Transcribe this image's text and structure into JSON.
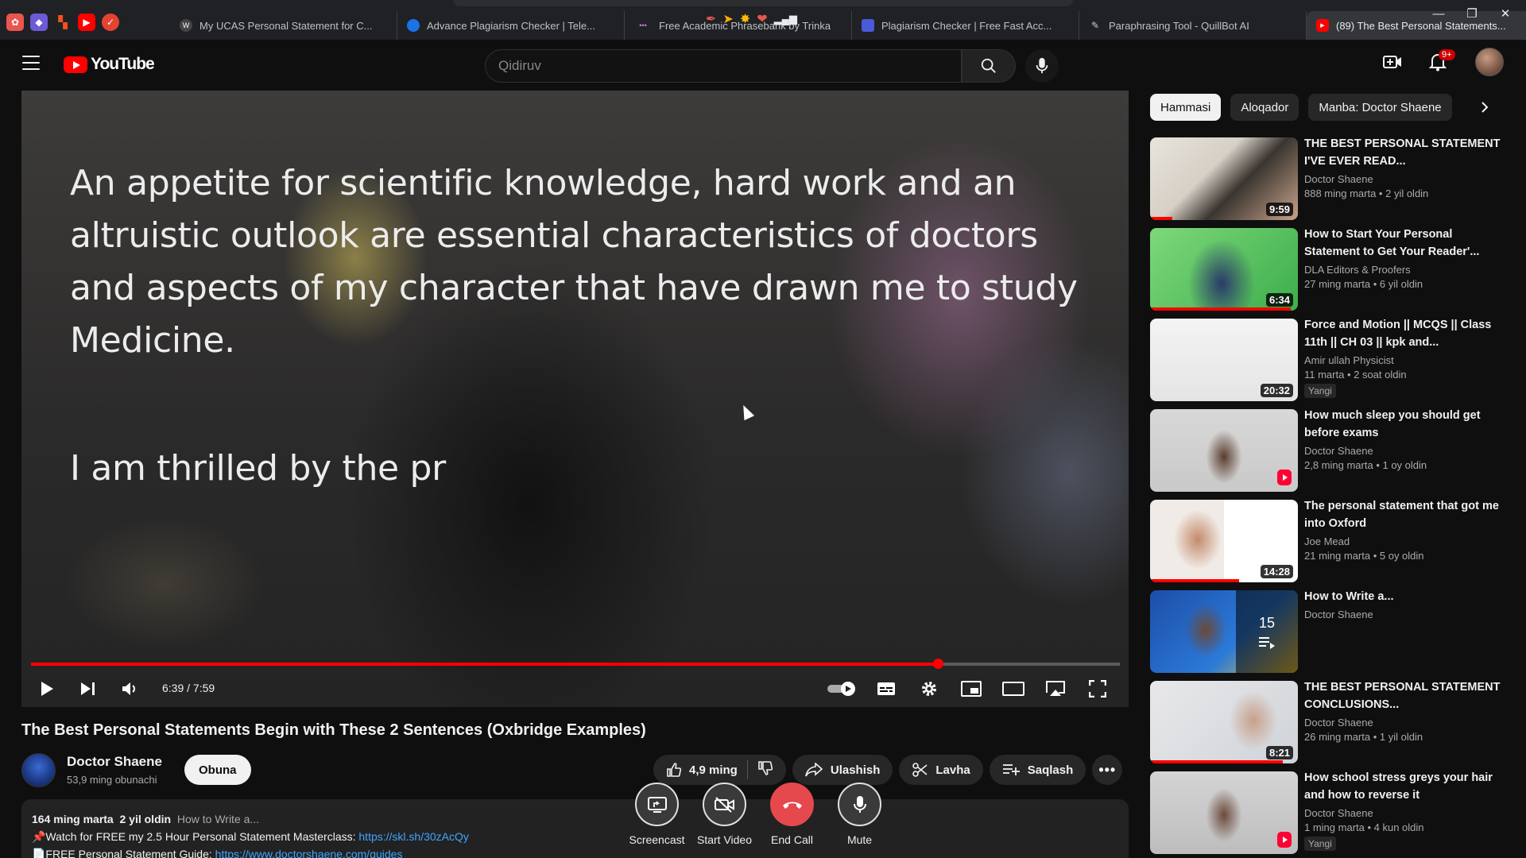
{
  "browser": {
    "tabs": [
      {
        "title": "My UCAS Personal Statement for C...",
        "fav": "W",
        "color": "#444"
      },
      {
        "title": "Advance Plagiarism Checker | Tele...",
        "fav": "",
        "color": "#1a73e8"
      },
      {
        "title": "Free Academic Phrasebank by Trinka",
        "fav": "•••",
        "color": "#202124"
      },
      {
        "title": "Plagiarism Checker | Free Fast Acc...",
        "fav": "",
        "color": "#4a5ad8"
      },
      {
        "title": "Paraphrasing Tool - QuillBot AI",
        "fav": "",
        "color": "#202124"
      },
      {
        "title": "(89) The Best Personal Statements...",
        "fav": "",
        "color": "#ff0000"
      }
    ]
  },
  "masthead": {
    "logo_text": "YouTube",
    "search_placeholder": "Qidiruv",
    "notification_count": "9+"
  },
  "player": {
    "caption_line1": "An appetite for scientific knowledge, hard work and an altruistic outlook are essential characteristics of doctors and aspects of my character that have drawn me to study Medicine.",
    "caption_line2": "I am thrilled by the pr",
    "time_display": "6:39 / 7:59",
    "progress_fraction": 0.833
  },
  "video": {
    "title": "The Best Personal Statements Begin with These 2 Sentences (Oxbridge Examples)",
    "channel": "Doctor Shaene",
    "subscribers": "53,9 ming obunachi",
    "subscribe_label": "Obuna",
    "likes": "4,9 ming",
    "share_label": "Ulashish",
    "clip_label": "Lavha",
    "save_label": "Saqlash"
  },
  "description": {
    "views": "164 ming marta",
    "age": "2 yil oldin",
    "playlist_hint": "How to Write a...",
    "line1_text": "📌Watch for FREE my 2.5 Hour Personal Statement Masterclass: ",
    "line1_link": "https://skl.sh/30zAcQy",
    "line2_text": "📄FREE Personal Statement Guide: ",
    "line2_link": "https://www.doctorshaene.com/guides"
  },
  "call": {
    "screencast": "Screencast",
    "start_video": "Start Video",
    "end_call": "End Call",
    "mute": "Mute"
  },
  "chips": [
    "Hammasi",
    "Aloqador",
    "Manba: Doctor Shaene"
  ],
  "recommendations": [
    {
      "title": "THE BEST PERSONAL STATEMENT I'VE EVER READ...",
      "channel": "Doctor Shaene",
      "meta": "888 ming marta • 2 yil oldin",
      "duration": "9:59",
      "badge": "",
      "watched": 0.15,
      "shorts": false
    },
    {
      "title": "How to Start Your Personal Statement to Get Your Reader'...",
      "channel": "DLA Editors & Proofers",
      "meta": "27 ming marta • 6 yil oldin",
      "duration": "6:34",
      "badge": "",
      "watched": 0.95,
      "shorts": false
    },
    {
      "title": "Force and Motion || MCQS || Class 11th || CH 03 || kpk and...",
      "channel": "Amir ullah Physicist",
      "meta": "11 marta • 2 soat oldin",
      "duration": "20:32",
      "badge": "Yangi",
      "watched": 0,
      "shorts": false
    },
    {
      "title": "How much sleep you should get before exams",
      "channel": "Doctor Shaene",
      "meta": "2,8 ming marta • 1 oy oldin",
      "duration": "",
      "badge": "",
      "watched": 0,
      "shorts": true
    },
    {
      "title": "The personal statement that got me into Oxford",
      "channel": "Joe Mead",
      "meta": "21 ming marta • 5 oy oldin",
      "duration": "14:28",
      "badge": "",
      "watched": 0.6,
      "shorts": false
    },
    {
      "title": "How to Write a...",
      "channel": "Doctor Shaene",
      "meta": "",
      "duration": "",
      "badge": "",
      "watched": 0,
      "shorts": false,
      "playlist_count": "15"
    },
    {
      "title": "THE BEST PERSONAL STATEMENT CONCLUSIONS...",
      "channel": "Doctor Shaene",
      "meta": "26 ming marta • 1 yil oldin",
      "duration": "8:21",
      "badge": "",
      "watched": 0.9,
      "shorts": false
    },
    {
      "title": "How school stress greys your hair and how to reverse it",
      "channel": "Doctor Shaene",
      "meta": "1 ming marta • 4 kun oldin",
      "duration": "",
      "badge": "Yangi",
      "watched": 0,
      "shorts": true
    }
  ]
}
